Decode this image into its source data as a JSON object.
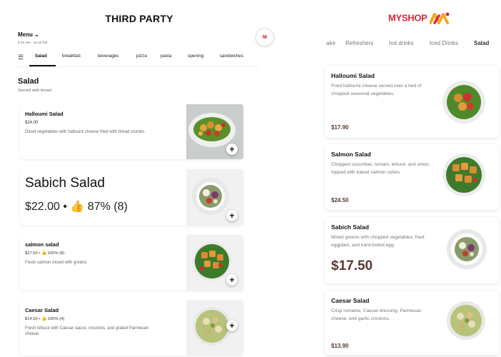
{
  "third_party": {
    "title": "THIRD PARTY",
    "menu_label": "Menu ⌄",
    "hours": "8:15 AM – 11:45 PM",
    "brand_badge": "M",
    "tabs": [
      {
        "label": "Salad",
        "active": true
      },
      {
        "label": "breakfast",
        "active": false
      },
      {
        "label": "beverages",
        "active": false
      },
      {
        "label": "pizza",
        "active": false
      },
      {
        "label": "pasta",
        "active": false
      },
      {
        "label": "opening",
        "active": false
      },
      {
        "label": "sandwiches",
        "active": false
      }
    ],
    "section": {
      "title": "Salad",
      "subtitle": "Served with bread."
    },
    "items": [
      {
        "name": "Halloumi Salad",
        "meta": "$24.00",
        "desc": "Diced vegetables with halloumi cheese fried with bread crumbs.",
        "add": "+"
      },
      {
        "name": "Sabich Salad",
        "meta": "$22.00 • 👍 87% (8)",
        "desc": "",
        "add": "+"
      },
      {
        "name": "salmon salad",
        "meta": "$27.50 • 👍 100% (8)",
        "desc": "Fresh salmon mixed with greens",
        "add": "+"
      },
      {
        "name": "Caesar Salad",
        "meta": "$14.50 • 👍 100% (4)",
        "desc": "Fresh lettuce with Caesar sauce, croutons, and grated Parmesan cheese.",
        "add": "+"
      }
    ]
  },
  "my_shop": {
    "logo_text": "MYSHOP",
    "tabs": [
      {
        "label": "ake",
        "active": false
      },
      {
        "label": "Refreshers",
        "active": false
      },
      {
        "label": "hot drinks",
        "active": false
      },
      {
        "label": "Iced Drinks",
        "active": false
      },
      {
        "label": "Salad",
        "active": true
      }
    ],
    "items": [
      {
        "name": "Halloumi Salad",
        "desc": "Fried halloumi cheese served over a bed of chopped seasonal vegetables.",
        "price": "$17.90"
      },
      {
        "name": "Salmon Salad",
        "desc": "Chopped cucumber, tomato, lettuce, and onion, topped with baked salmon cubes.",
        "price": "$24.50"
      },
      {
        "name": "Sabich Salad",
        "desc": "Mixed greens with chopped vegetables, fried eggplant, and hard-boiled egg.",
        "price": "$17.50"
      },
      {
        "name": "Caesar Salad",
        "desc": "Crisp romaine, Caesar dressing, Parmesan cheese, and garlic croutons.",
        "price": "$13.90"
      }
    ]
  },
  "colors": {
    "brand_red": "#d7263d",
    "brand_orange": "#f5a623",
    "price_brown": "#5a3a32"
  },
  "icons": [
    "list-icon",
    "plus-icon",
    "thumbs-up-icon",
    "shop-logo-icon"
  ]
}
